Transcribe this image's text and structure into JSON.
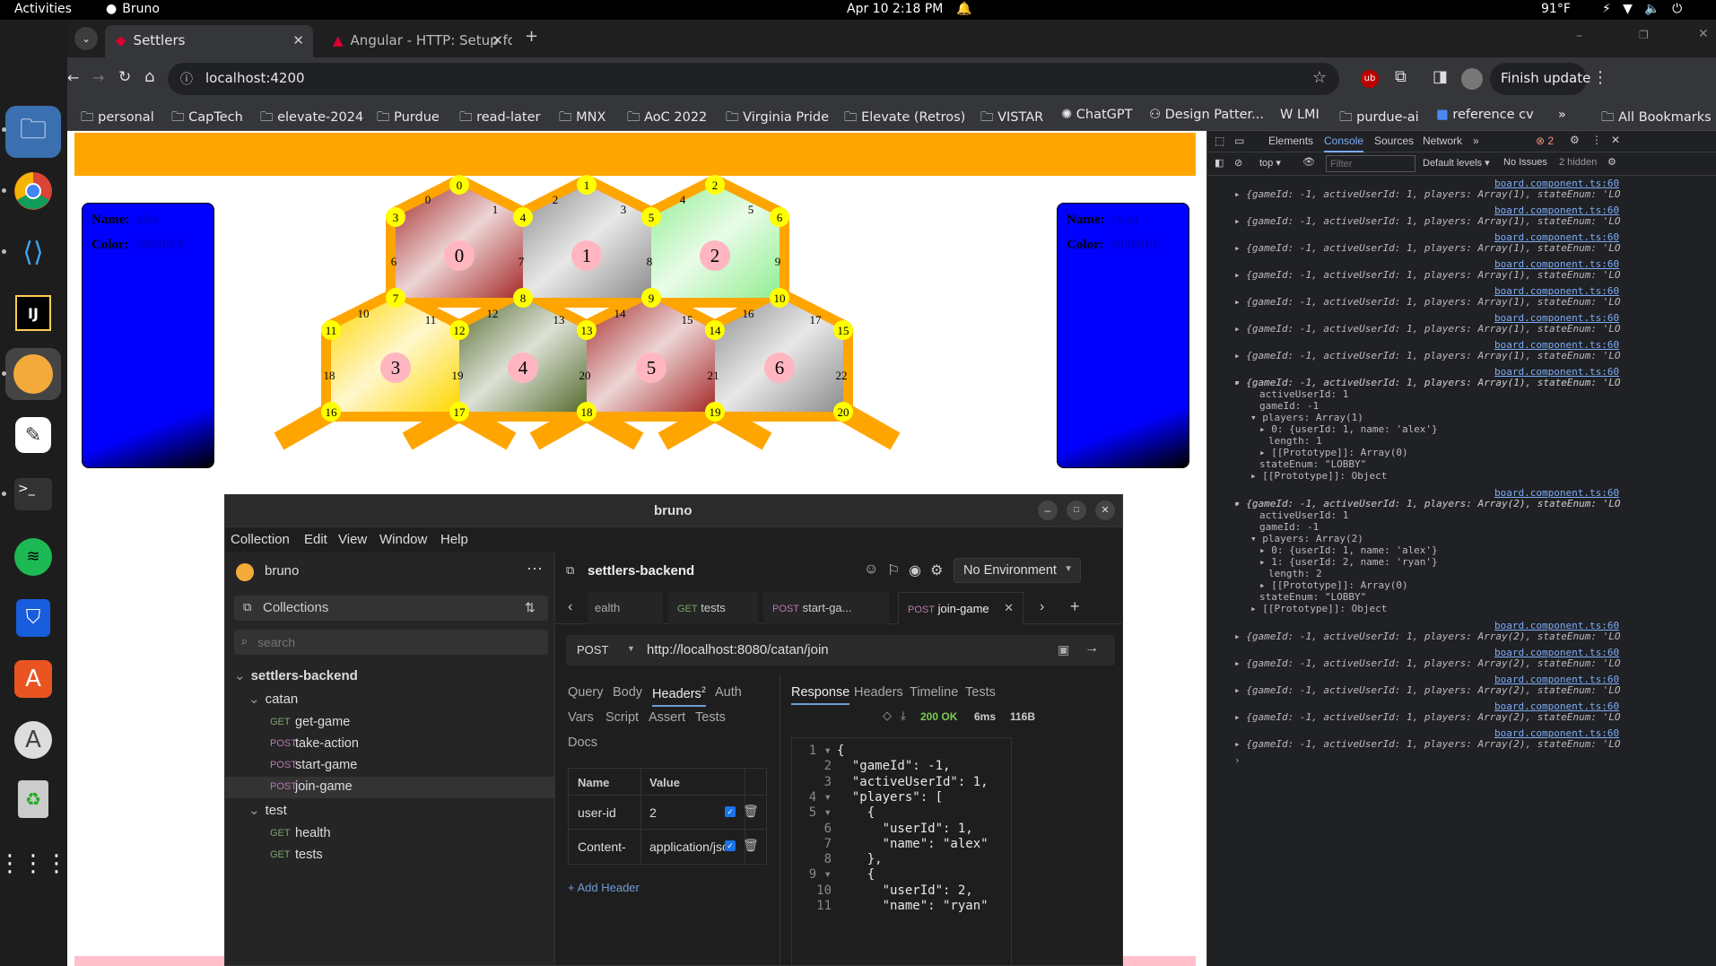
{
  "topbar": {
    "activities": "Activities",
    "app": "Bruno",
    "clock": "Apr 10  2:18 PM",
    "temp": "91°F"
  },
  "browser": {
    "tabs": [
      {
        "title": "Settlers"
      },
      {
        "title": "Angular - HTTP: Setup fo"
      }
    ],
    "url": "localhost:4200",
    "finish_update": "Finish update",
    "bookmarks": [
      "personal",
      "CapTech",
      "elevate-2024",
      "Purdue",
      "read-later",
      "MNX",
      "AoC 2022",
      "Virginia Pride",
      "Elevate (Retros)",
      "VISTAR",
      "ChatGPT",
      "Design Patter...",
      "LMI",
      "purdue-ai",
      "reference cv"
    ],
    "all_bookmarks": "All Bookmarks"
  },
  "game": {
    "colors": {
      "banner": "#FFA500",
      "player": "#0000FF",
      "road": "#FFA500",
      "node": "#FFFF00"
    },
    "players": [
      {
        "name_label": "Name",
        "name": "alex",
        "color_label": "Color",
        "color": "#0000FF"
      },
      {
        "name_label": "Name",
        "name": "ryan",
        "color_label": "Color",
        "color": "#0000FF"
      }
    ],
    "tiles": [
      {
        "n": "0",
        "color": "#a52a2a"
      },
      {
        "n": "1",
        "color": "#8c8c8c"
      },
      {
        "n": "2",
        "color": "#90ee90"
      },
      {
        "n": "3",
        "color": "#ffd700"
      },
      {
        "n": "4",
        "color": "#556b2f"
      },
      {
        "n": "5",
        "color": "#a52a2a"
      },
      {
        "n": "6",
        "color": "#8c8c8c"
      }
    ],
    "nodes": [
      "0",
      "1",
      "2",
      "3",
      "4",
      "5",
      "6",
      "7",
      "8",
      "9",
      "10",
      "11",
      "12",
      "13",
      "14",
      "15",
      "16",
      "17",
      "18",
      "19",
      "20"
    ],
    "edges": [
      "0",
      "1",
      "2",
      "3",
      "4",
      "5",
      "6",
      "7",
      "8",
      "9",
      "10",
      "11",
      "12",
      "13",
      "14",
      "15",
      "16",
      "17",
      "18",
      "19",
      "20",
      "21",
      "22"
    ]
  },
  "devtools": {
    "tabs": [
      "Elements",
      "Console",
      "Sources",
      "Network"
    ],
    "error_count": "2",
    "context": "top",
    "filter_placeholder": "Filter",
    "levels": "Default levels",
    "issues": "No Issues",
    "hidden": "2 hidden",
    "link": "board.component.ts:60",
    "log_one": "{gameId: -1, activeUserId: 1, players: Array(1), stateEnum: 'LOBBY'}",
    "log_two": "{gameId: -1, activeUserId: 1, players: Array(2), stateEnum: 'LOBBY'}",
    "exp1": [
      "activeUserId: 1",
      "gameId: -1",
      "players: Array(1)",
      "0: {userId: 1, name: 'alex'}",
      "length: 1",
      "[[Prototype]]: Array(0)",
      "stateEnum: \"LOBBY\"",
      "[[Prototype]]: Object"
    ],
    "exp2": [
      "activeUserId: 1",
      "gameId: -1",
      "players: Array(2)",
      "0: {userId: 1, name: 'alex'}",
      "1: {userId: 2, name: 'ryan'}",
      "length: 2",
      "[[Prototype]]: Array(0)",
      "stateEnum: \"LOBBY\"",
      "[[Prototype]]: Object"
    ]
  },
  "bruno": {
    "title": "bruno",
    "menu": [
      "Collection",
      "Edit",
      "View",
      "Window",
      "Help"
    ],
    "workspace": "bruno",
    "collections_label": "Collections",
    "search_placeholder": "search",
    "collection": "settlers-backend",
    "folders": [
      {
        "name": "catan",
        "items": [
          {
            "method": "GET",
            "name": "get-game"
          },
          {
            "method": "POST",
            "name": "take-action"
          },
          {
            "method": "POST",
            "name": "start-game"
          },
          {
            "method": "POST",
            "name": "join-game"
          }
        ]
      },
      {
        "name": "test",
        "items": [
          {
            "method": "GET",
            "name": "health"
          },
          {
            "method": "GET",
            "name": "tests"
          }
        ]
      }
    ],
    "header_title": "settlers-backend",
    "environment": "No Environment",
    "req_tabs": [
      {
        "method": "",
        "name": "ealth"
      },
      {
        "method": "GET",
        "name": "tests"
      },
      {
        "method": "POST",
        "name": "start-ga..."
      },
      {
        "method": "POST",
        "name": "join-game"
      }
    ],
    "method": "POST",
    "url": "http://localhost:8080/catan/join",
    "left_tabs": [
      "Query",
      "Body",
      "Headers",
      "Auth",
      "Vars",
      "Script",
      "Assert",
      "Tests",
      "Docs"
    ],
    "headers_count": "2",
    "table_headers": [
      "Name",
      "Value"
    ],
    "rows": [
      {
        "name": "user-id",
        "value": "2"
      },
      {
        "name": "Content-",
        "value": "application/jso"
      }
    ],
    "add_header": "+ Add Header",
    "right_tabs": [
      "Response",
      "Headers",
      "Timeline",
      "Tests"
    ],
    "status": "200 OK",
    "time": "6ms",
    "size": "116B",
    "code": [
      {
        "ln": "1",
        "tx": "{"
      },
      {
        "ln": "2",
        "tx": "  \"gameId\": -1,"
      },
      {
        "ln": "3",
        "tx": "  \"activeUserId\": 1,"
      },
      {
        "ln": "4",
        "tx": "  \"players\": ["
      },
      {
        "ln": "5",
        "tx": "    {"
      },
      {
        "ln": "6",
        "tx": "      \"userId\": 1,"
      },
      {
        "ln": "7",
        "tx": "      \"name\": \"alex\""
      },
      {
        "ln": "8",
        "tx": "    },"
      },
      {
        "ln": "9",
        "tx": "    {"
      },
      {
        "ln": "10",
        "tx": "      \"userId\": 2,"
      },
      {
        "ln": "11",
        "tx": "      \"name\": \"ryan\""
      }
    ]
  }
}
